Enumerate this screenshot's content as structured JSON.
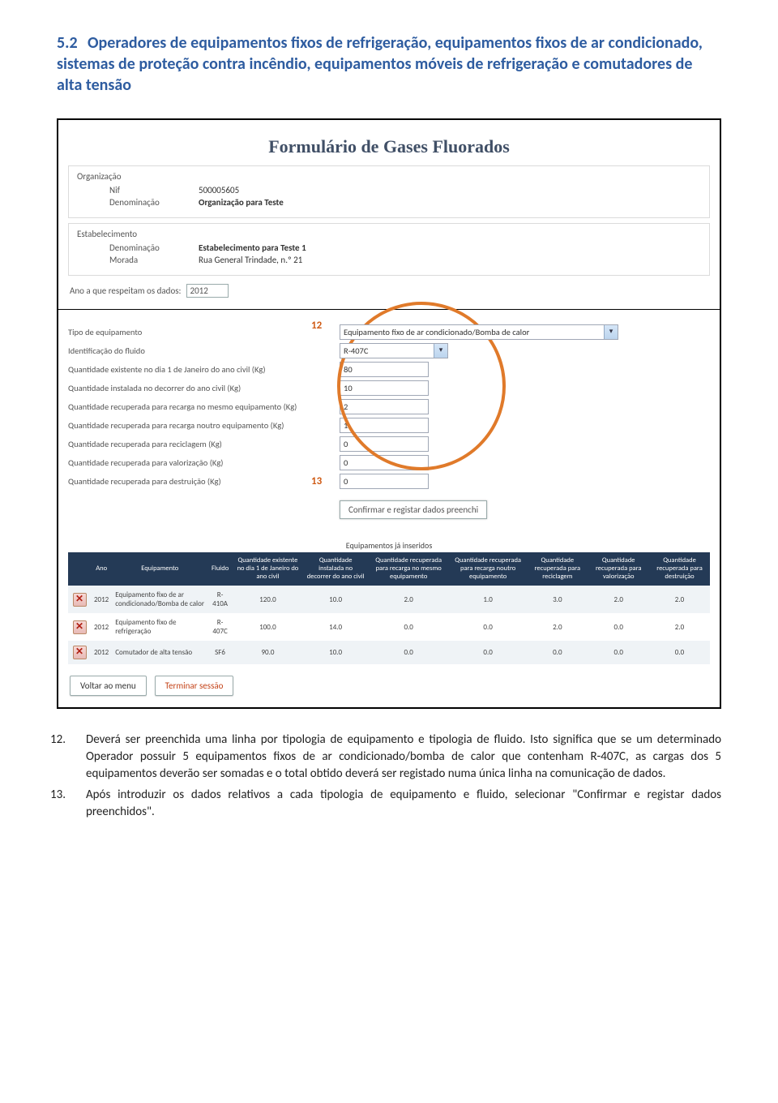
{
  "section": {
    "number": "5.2",
    "title": "Operadores de equipamentos fixos de refrigeração, equipamentos fixos de ar condicionado, sistemas de proteção contra incêndio, equipamentos móveis de refrigeração e comutadores de alta tensão"
  },
  "form": {
    "title": "Formulário de Gases Fluorados",
    "org_heading": "Organização",
    "org_nif_label": "Nif",
    "org_nif_value": "500005605",
    "org_denom_label": "Denominação",
    "org_denom_value": "Organização para Teste",
    "estab_heading": "Estabelecimento",
    "estab_denom_label": "Denominação",
    "estab_denom_value": "Estabelecimento para Teste 1",
    "estab_morada_label": "Morada",
    "estab_morada_value": "Rua General Trindade, n.º 21",
    "year_label": "Ano a que respeitam os dados:",
    "year_value": "2012",
    "f_tipo_label": "Tipo de equipamento",
    "f_tipo_value": "Equipamento fixo de ar condicionado/Bomba de calor",
    "f_fluido_label": "Identificação do fluido",
    "f_fluido_value": "R-407C",
    "f_q1_label": "Quantidade existente no dia 1 de Janeiro do ano civil (Kg)",
    "f_q1_value": "80",
    "f_q2_label": "Quantidade instalada no decorrer do ano civil (Kg)",
    "f_q2_value": "10",
    "f_q3_label": "Quantidade recuperada para recarga no mesmo equipamento (Kg)",
    "f_q3_value": "2",
    "f_q4_label": "Quantidade recuperada para recarga noutro equipamento (Kg)",
    "f_q4_value": "1",
    "f_q5_label": "Quantidade recuperada para reciclagem (Kg)",
    "f_q5_value": "0",
    "f_q6_label": "Quantidade recuperada para valorização (Kg)",
    "f_q6_value": "0",
    "f_q7_label": "Quantidade recuperada para destruição (Kg)",
    "f_q7_value": "0",
    "confirm_label": "Confirmar e registar dados preenchi",
    "callout12": "12",
    "callout13": "13",
    "table_title": "Equipamentos já inseridos",
    "headers": {
      "ano": "Ano",
      "equip": "Equipamento",
      "fluido": "Fluido",
      "q_exist": "Quantidade existente no dia 1 de Janeiro do ano civil",
      "q_inst": "Quantidade instalada no decorrer do ano civil",
      "q_recmesmo": "Quantidade recuperada para recarga no mesmo equipamento",
      "q_recoutro": "Quantidade recuperada para recarga noutro equipamento",
      "q_recic": "Quantidade recuperada para reciclagem",
      "q_valor": "Quantidade recuperada para valorização",
      "q_destr": "Quantidade recuperada para destruição"
    },
    "rows": [
      {
        "ano": "2012",
        "equip": "Equipamento fixo de ar condicionado/Bomba de calor",
        "fluido": "R-410A",
        "q1": "120.0",
        "q2": "10.0",
        "q3": "2.0",
        "q4": "1.0",
        "q5": "3.0",
        "q6": "2.0",
        "q7": "2.0"
      },
      {
        "ano": "2012",
        "equip": "Equipamento fixo de refrigeração",
        "fluido": "R-407C",
        "q1": "100.0",
        "q2": "14.0",
        "q3": "0.0",
        "q4": "0.0",
        "q5": "2.0",
        "q6": "0.0",
        "q7": "2.0"
      },
      {
        "ano": "2012",
        "equip": "Comutador de alta tensão",
        "fluido": "SF6",
        "q1": "90.0",
        "q2": "10.0",
        "q3": "0.0",
        "q4": "0.0",
        "q5": "0.0",
        "q6": "0.0",
        "q7": "0.0"
      }
    ],
    "btn_menu": "Voltar ao menu",
    "btn_logout": "Terminar sessão"
  },
  "body": {
    "p12_num": "12.",
    "p12": "Deverá ser preenchida uma linha por tipologia de equipamento e tipologia de fluido. Isto significa que se um determinado Operador possuir 5 equipamentos fixos de ar condicionado/bomba de calor que contenham R-407C, as cargas dos 5 equipamentos deverão ser somadas e o total obtido deverá ser registado numa única linha na comunicação de dados.",
    "p13_num": "13.",
    "p13": "Após introduzir os dados relativos a cada tipologia de equipamento e fluido, selecionar \"Confirmar e registar dados preenchidos\"."
  }
}
